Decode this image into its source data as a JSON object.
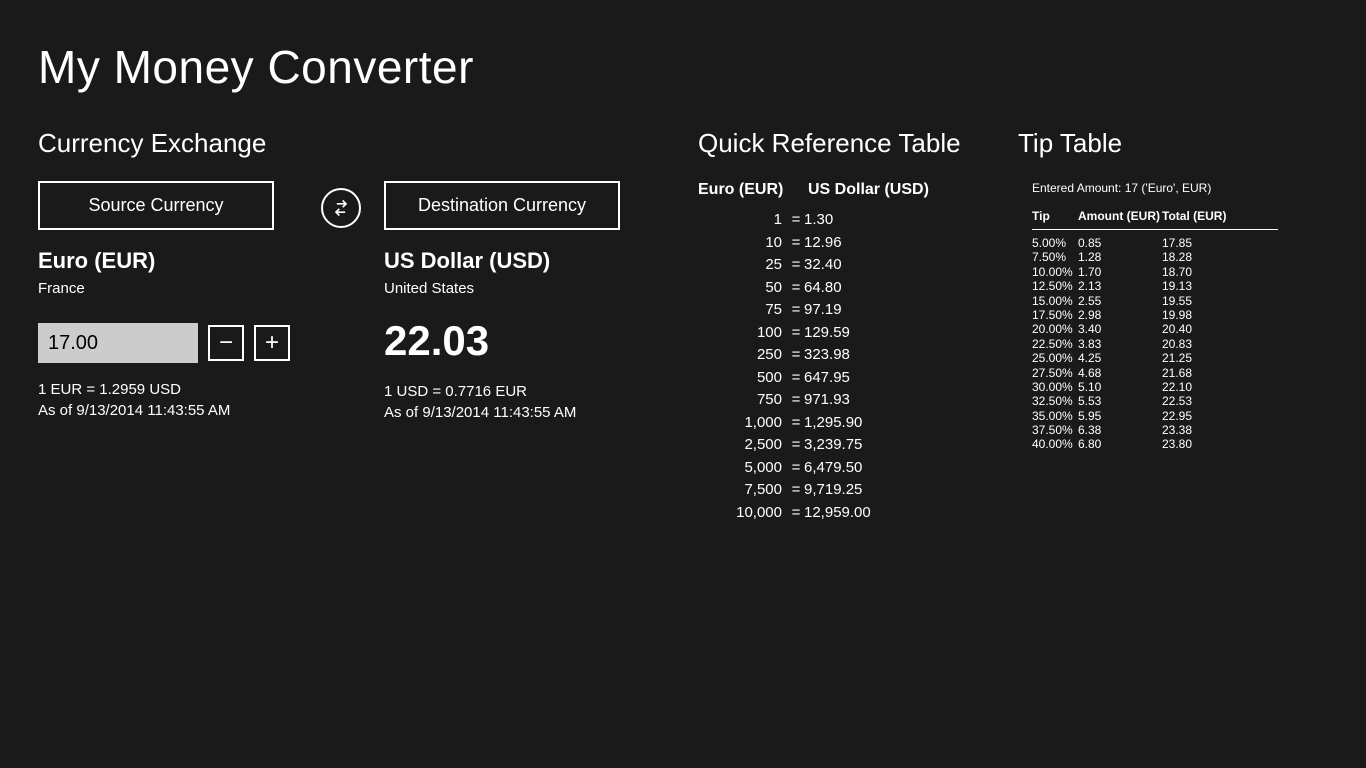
{
  "app_title": "My Money Converter",
  "exchange": {
    "section_title": "Currency Exchange",
    "source_btn": "Source Currency",
    "dest_btn": "Destination Currency",
    "source": {
      "name": "Euro (EUR)",
      "country": "France",
      "amount": "17.00",
      "rate_line": "1 EUR = 1.2959 USD",
      "asof": "As of 9/13/2014 11:43:55 AM"
    },
    "dest": {
      "name": "US Dollar (USD)",
      "country": "United States",
      "converted": "22.03",
      "rate_line": "1 USD = 0.7716 EUR",
      "asof": "As of 9/13/2014 11:43:55 AM"
    }
  },
  "quickref": {
    "section_title": "Quick Reference Table",
    "col1": "Euro (EUR)",
    "col2": "US Dollar (USD)",
    "rows": [
      {
        "a": "1",
        "b": "1.30"
      },
      {
        "a": "10",
        "b": "12.96"
      },
      {
        "a": "25",
        "b": "32.40"
      },
      {
        "a": "50",
        "b": "64.80"
      },
      {
        "a": "75",
        "b": "97.19"
      },
      {
        "a": "100",
        "b": "129.59"
      },
      {
        "a": "250",
        "b": "323.98"
      },
      {
        "a": "500",
        "b": "647.95"
      },
      {
        "a": "750",
        "b": "971.93"
      },
      {
        "a": "1,000",
        "b": "1,295.90"
      },
      {
        "a": "2,500",
        "b": "3,239.75"
      },
      {
        "a": "5,000",
        "b": "6,479.50"
      },
      {
        "a": "7,500",
        "b": "9,719.25"
      },
      {
        "a": "10,000",
        "b": "12,959.00"
      }
    ]
  },
  "tip": {
    "section_title": "Tip Table",
    "entered": "Entered Amount: 17 ('Euro', EUR)",
    "head_tip": "Tip",
    "head_amount": "Amount (EUR)",
    "head_total": "Total (EUR)",
    "rows": [
      {
        "p": "5.00%",
        "a": "0.85",
        "t": "17.85"
      },
      {
        "p": "7.50%",
        "a": "1.28",
        "t": "18.28"
      },
      {
        "p": "10.00%",
        "a": "1.70",
        "t": "18.70"
      },
      {
        "p": "12.50%",
        "a": "2.13",
        "t": "19.13"
      },
      {
        "p": "15.00%",
        "a": "2.55",
        "t": "19.55"
      },
      {
        "p": "17.50%",
        "a": "2.98",
        "t": "19.98"
      },
      {
        "p": "20.00%",
        "a": "3.40",
        "t": "20.40"
      },
      {
        "p": "22.50%",
        "a": "3.83",
        "t": "20.83"
      },
      {
        "p": "25.00%",
        "a": "4.25",
        "t": "21.25"
      },
      {
        "p": "27.50%",
        "a": "4.68",
        "t": "21.68"
      },
      {
        "p": "30.00%",
        "a": "5.10",
        "t": "22.10"
      },
      {
        "p": "32.50%",
        "a": "5.53",
        "t": "22.53"
      },
      {
        "p": "35.00%",
        "a": "5.95",
        "t": "22.95"
      },
      {
        "p": "37.50%",
        "a": "6.38",
        "t": "23.38"
      },
      {
        "p": "40.00%",
        "a": "6.80",
        "t": "23.80"
      }
    ]
  }
}
